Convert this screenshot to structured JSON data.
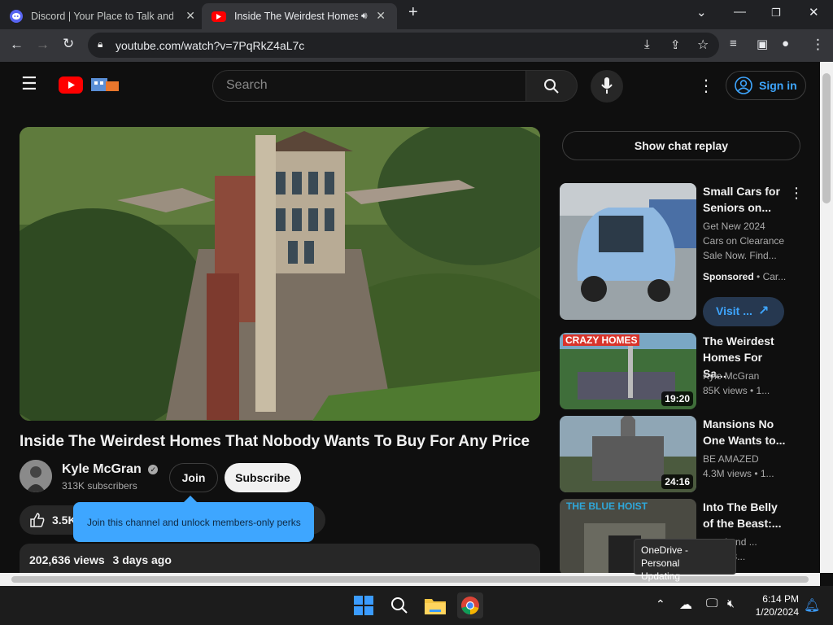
{
  "browser": {
    "tabs": [
      {
        "title": "Discord | Your Place to Talk and Hang Out"
      },
      {
        "title": "Inside The Weirdest Homes That Nobody Wants To Buy"
      }
    ],
    "url": "youtube.com/watch?v=7PqRkZ4aL7c"
  },
  "youtube": {
    "search_placeholder": "Search",
    "sign_in": "Sign in",
    "video": {
      "title": "Inside The Weirdest Homes That Nobody Wants To Buy For Any Price",
      "channel": "Kyle McGran",
      "subscribers": "313K subscribers",
      "join": "Join",
      "subscribe": "Subscribe",
      "likes": "3.5K",
      "join_tooltip": "Join this channel and unlock members-only perks",
      "views": "202,636 views",
      "date": "3 days ago"
    },
    "chat_replay": "Show chat replay",
    "sidebar": [
      {
        "title": "Small Cars for Seniors on...",
        "meta1": "Get New 2024 Cars on Clearance Sale Now. Find...",
        "sponsored": "Sponsored",
        "source": "Car...",
        "visit": "Visit ..."
      },
      {
        "title": "The Weirdest Homes For Sa...",
        "channel": "Kyle McGran",
        "stats": "85K views • 1...",
        "duration": "19:20",
        "thumb_text": "CRAZY HOMES"
      },
      {
        "title": "Mansions No One Wants to...",
        "channel": "BE AMAZED",
        "stats": "4.3M views • 1...",
        "duration": "24:16"
      },
      {
        "title": "Into The Belly of the Beast:...",
        "channel": "...ned and ...",
        "stats": "...ws • 8...",
        "thumb_text": "THE BLUE HOIST"
      }
    ]
  },
  "tooltip": {
    "line1": "OneDrive - Personal",
    "line2": "Updating"
  },
  "taskbar": {
    "time": "6:14 PM",
    "date": "1/20/2024"
  }
}
